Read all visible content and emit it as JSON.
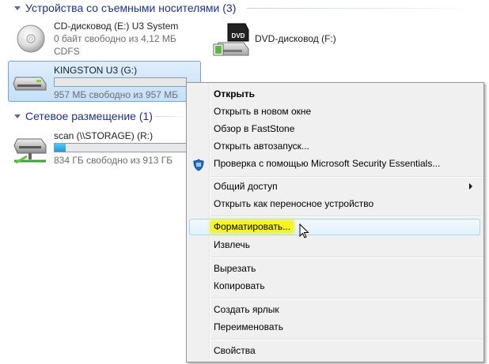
{
  "sections": {
    "removable": {
      "title": "Устройства со съемными носителями (3)"
    },
    "network": {
      "title": "Сетевое размещение (1)"
    }
  },
  "drives": {
    "cd": {
      "name": "CD-дисковод (E:) U3 System",
      "free": "0 байт свободно из 4,12 МБ",
      "fs": "CDFS",
      "icon": "cd-drive-icon"
    },
    "dvd": {
      "name": "DVD-дисковод (F:)",
      "icon": "dvd-drive-icon",
      "icon_label": "DVD"
    },
    "kingston": {
      "name": "KINGSTON U3 (G:)",
      "free": "957 МБ свободно из 957 МБ",
      "usage_fraction": 0.0,
      "icon": "usb-drive-icon"
    },
    "scan": {
      "name": "scan (\\\\STORAGE) (R:)",
      "free": "834 ГБ свободно из 913 ГБ",
      "usage_fraction": 0.087,
      "icon": "network-drive-icon"
    }
  },
  "context_menu": {
    "items": [
      {
        "label": "Открыть",
        "bold": true
      },
      {
        "label": "Открыть в новом окне"
      },
      {
        "label": "Обзор в FastStone"
      },
      {
        "label": "Открыть автозапуск..."
      },
      {
        "label": "Проверка с помощью Microsoft Security Essentials...",
        "icon": "security-essentials-icon"
      },
      {
        "label": "Общий доступ",
        "submenu": true
      },
      {
        "label": "Открыть как переносное устройство"
      },
      {
        "label": "Форматировать...",
        "highlighted": true
      },
      {
        "label": "Извлечь"
      },
      {
        "label": "Вырезать"
      },
      {
        "label": "Копировать"
      },
      {
        "label": "Создать ярлык"
      },
      {
        "label": "Переименовать"
      },
      {
        "label": "Свойства"
      }
    ]
  },
  "colors": {
    "section_header": "#1e3287",
    "progress_fill": "#26a0da",
    "highlight": "#f7f51d",
    "selection": "#cce4f9"
  }
}
